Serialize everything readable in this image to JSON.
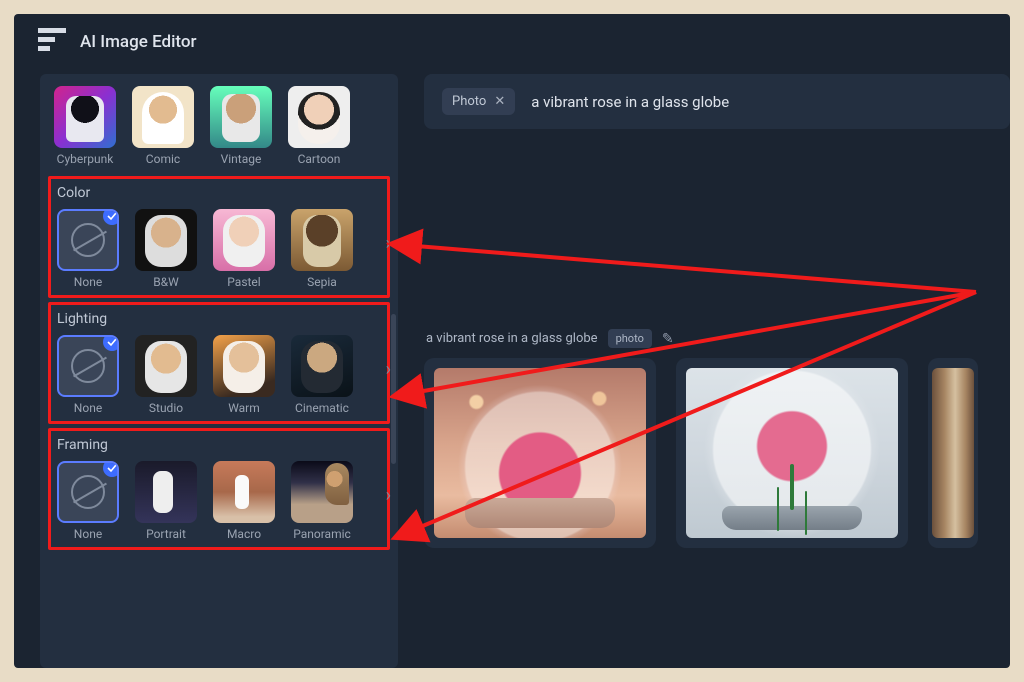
{
  "app": {
    "title": "AI Image Editor"
  },
  "prompt": {
    "tag_label": "Photo",
    "text": "a vibrant rose in a glass globe"
  },
  "generation": {
    "prompt_echo": "a vibrant rose in a glass globe",
    "tag_badge": "photo"
  },
  "sidebar": {
    "styles_row": {
      "items": [
        {
          "label": "Cyberpunk"
        },
        {
          "label": "Comic"
        },
        {
          "label": "Vintage"
        },
        {
          "label": "Cartoon"
        }
      ]
    },
    "sections": [
      {
        "title": "Color",
        "items": [
          {
            "label": "None",
            "selected": true
          },
          {
            "label": "B&W"
          },
          {
            "label": "Pastel"
          },
          {
            "label": "Sepia"
          }
        ]
      },
      {
        "title": "Lighting",
        "items": [
          {
            "label": "None",
            "selected": true
          },
          {
            "label": "Studio"
          },
          {
            "label": "Warm"
          },
          {
            "label": "Cinematic"
          }
        ]
      },
      {
        "title": "Framing",
        "items": [
          {
            "label": "None",
            "selected": true
          },
          {
            "label": "Portrait"
          },
          {
            "label": "Macro"
          },
          {
            "label": "Panoramic"
          }
        ]
      }
    ]
  },
  "annotation": {
    "highlighted_sections": [
      "Color",
      "Lighting",
      "Framing"
    ],
    "arrow_color": "#f01b1b"
  }
}
